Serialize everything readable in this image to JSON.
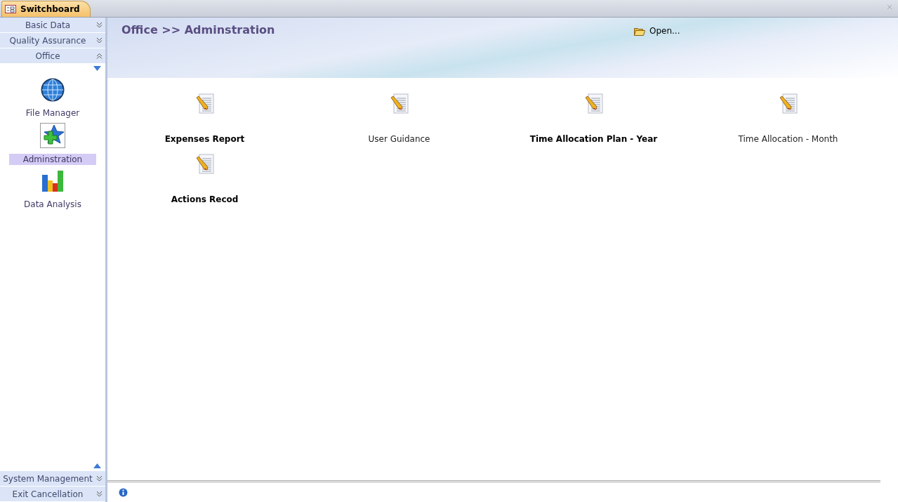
{
  "document_tab": {
    "title": "Switchboard"
  },
  "sidebar": {
    "top_groups": [
      {
        "label": "Basic Data",
        "expanded": false
      },
      {
        "label": "Quality Assurance",
        "expanded": false
      },
      {
        "label": "Office",
        "expanded": true
      }
    ],
    "items": [
      {
        "label": "File Manager",
        "kind": "globe",
        "selected": false
      },
      {
        "label": "Adminstration",
        "kind": "star",
        "selected": true
      },
      {
        "label": "Data Analysis",
        "kind": "chart",
        "selected": false
      }
    ],
    "bottom_groups": [
      {
        "label": "System Management",
        "expanded": false
      },
      {
        "label": "Exit Cancellation",
        "expanded": false
      }
    ]
  },
  "header": {
    "breadcrumb": "Office >> Adminstration",
    "open_button": "Open..."
  },
  "entries": [
    {
      "label": "Expenses Report",
      "kind": "medium"
    },
    {
      "label": "User Guidance",
      "kind": "plain"
    },
    {
      "label": "Time Allocation Plan - Year",
      "kind": "strong"
    },
    {
      "label": "Time Allocation - Month",
      "kind": "plain"
    },
    {
      "label": "Actions Recod",
      "kind": "medium"
    }
  ]
}
